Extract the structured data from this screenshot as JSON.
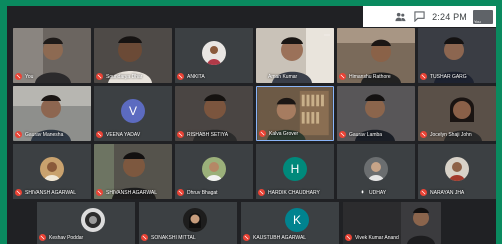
{
  "topbar": {
    "time": "2:24 PM",
    "self_label": "You",
    "icons": [
      "people-icon",
      "chat-icon"
    ]
  },
  "participants": [
    {
      "name": "You",
      "muted": true
    },
    {
      "name": "Soundarya Dhar",
      "muted": true
    },
    {
      "name": "ANKITA",
      "muted": true
    },
    {
      "name": "Aman Kumar",
      "muted": false
    },
    {
      "name": "Himanshu Rathore",
      "muted": true
    },
    {
      "name": "TUSHAR GARG",
      "muted": true
    },
    {
      "name": "Gaurav Manesha",
      "muted": true
    },
    {
      "name": "VEENA YADAV",
      "muted": true,
      "initial": "V"
    },
    {
      "name": "RISHABH SETIYA",
      "muted": true
    },
    {
      "name": "Kalva Grover",
      "muted": true
    },
    {
      "name": "Gaurav Lamba",
      "muted": true
    },
    {
      "name": "Jocelyn Shaji John",
      "muted": true
    },
    {
      "name": "SHIVANSH AGARWAL",
      "muted": true
    },
    {
      "name": "SHIVANSH AGARWAL",
      "muted": true
    },
    {
      "name": "Dhruv Bhagat",
      "muted": true
    },
    {
      "name": "HARDIK CHAUDHARY",
      "muted": true,
      "initial": "H"
    },
    {
      "name": "UDHAY",
      "muted": true
    },
    {
      "name": "NARAYAN JHA",
      "muted": true
    },
    {
      "name": "Keshav Poddar",
      "muted": true
    },
    {
      "name": "SONAKSHI MITTAL",
      "muted": true
    },
    {
      "name": "KAUSTUBH AGARWAL",
      "muted": true,
      "initial": "K"
    },
    {
      "name": "Vivek Kumar Anand",
      "muted": true
    }
  ],
  "colors": {
    "background": "#0a8a5f",
    "meet_dark": "#202124",
    "tile": "#3c4043",
    "muted_red": "#ea4335",
    "veena_avatar": "#5c6bc0",
    "hardik_avatar": "#00897b",
    "kaustubh_avatar": "#00838f"
  }
}
